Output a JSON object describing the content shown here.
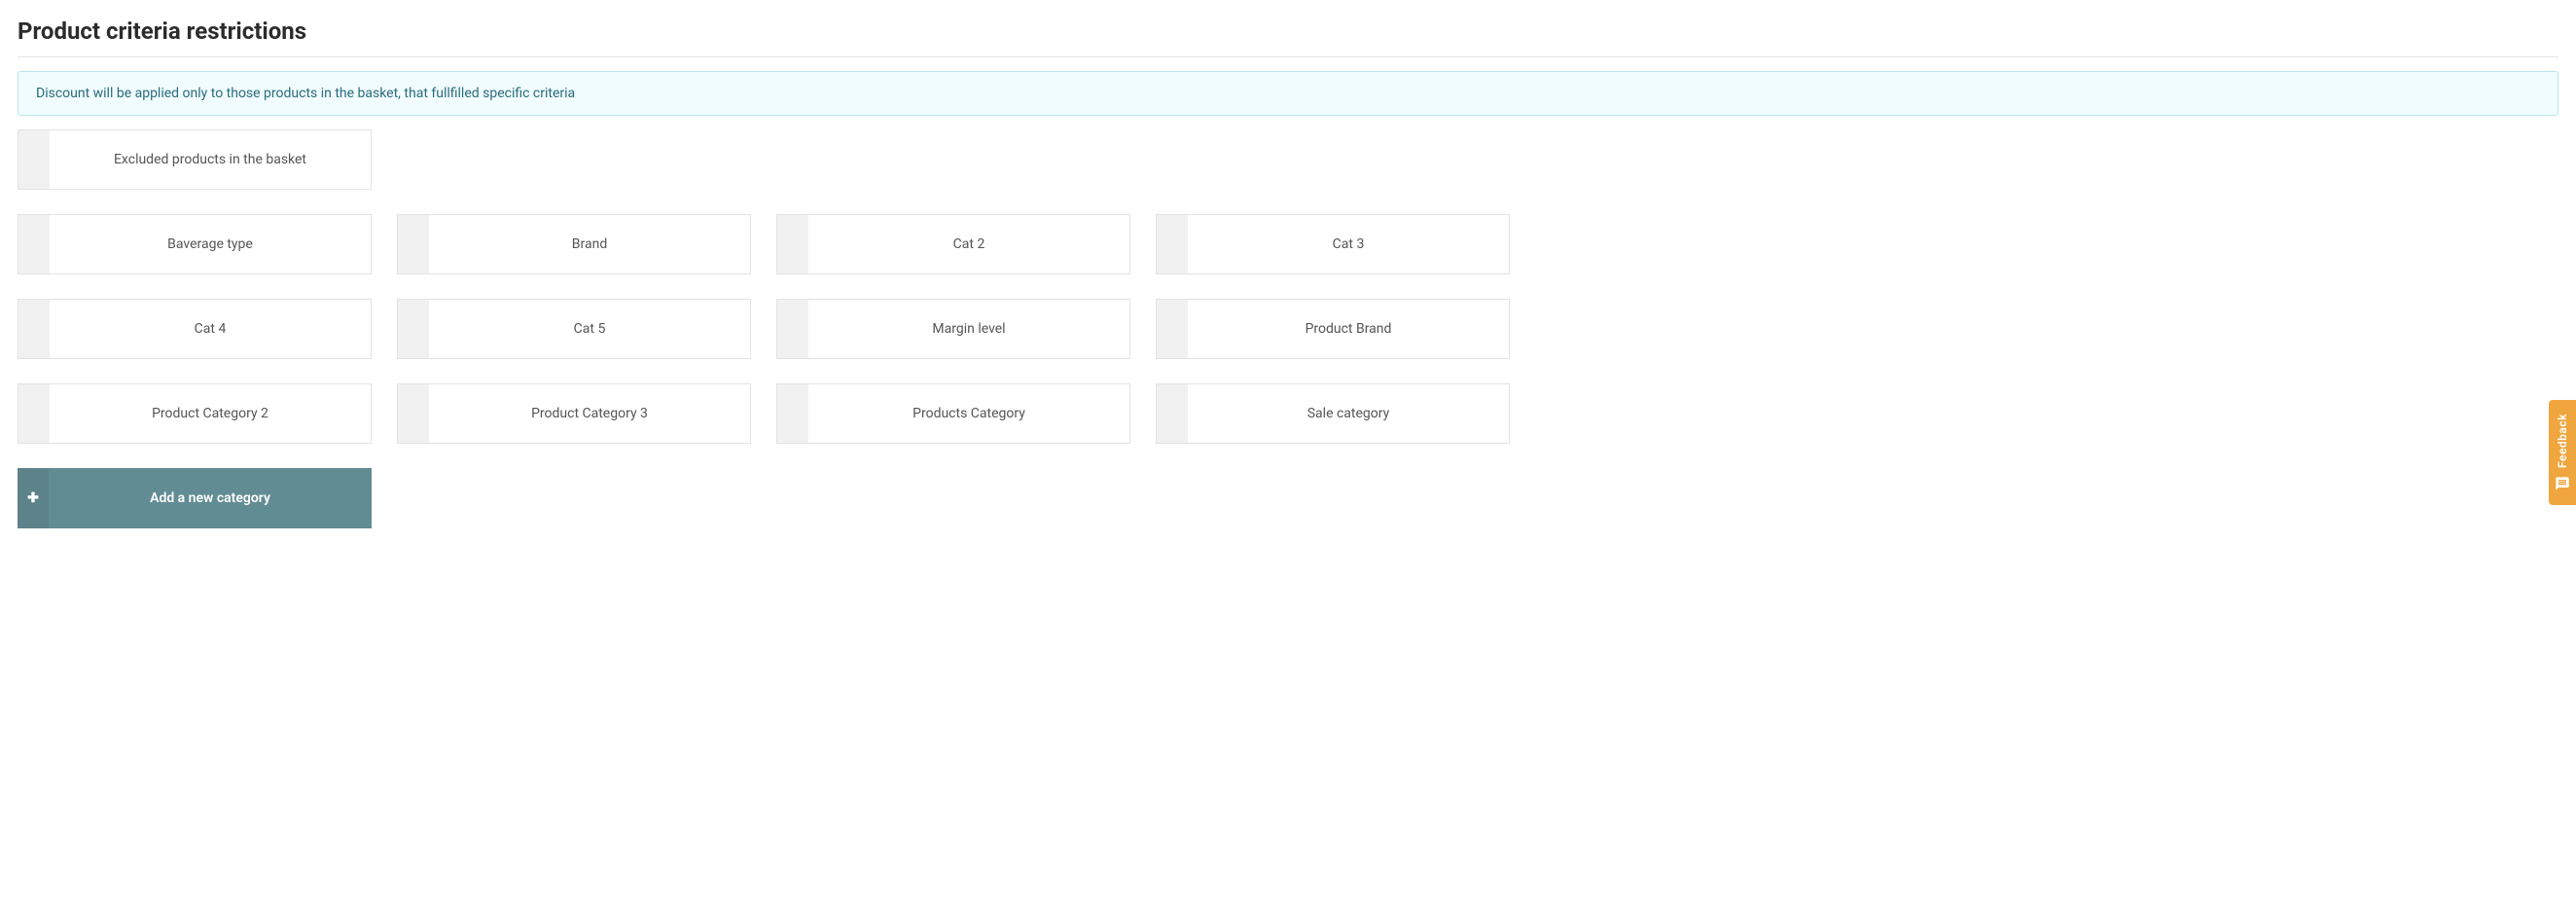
{
  "page": {
    "title": "Product criteria restrictions"
  },
  "banner": {
    "text": "Discount will be applied only to those products in the basket, that fullfilled specific criteria"
  },
  "topCard": {
    "label": "Excluded products in the basket"
  },
  "categories": {
    "row1": [
      {
        "label": "Baverage type"
      },
      {
        "label": "Brand"
      },
      {
        "label": "Cat 2"
      },
      {
        "label": "Cat 3"
      }
    ],
    "row2": [
      {
        "label": "Cat 4"
      },
      {
        "label": "Cat 5"
      },
      {
        "label": "Margin level"
      },
      {
        "label": "Product Brand"
      }
    ],
    "row3": [
      {
        "label": "Product Category 2"
      },
      {
        "label": "Product Category 3"
      },
      {
        "label": "Products Category"
      },
      {
        "label": "Sale category"
      }
    ]
  },
  "addButton": {
    "label": "Add a new category"
  },
  "feedback": {
    "label": "Feedback"
  }
}
